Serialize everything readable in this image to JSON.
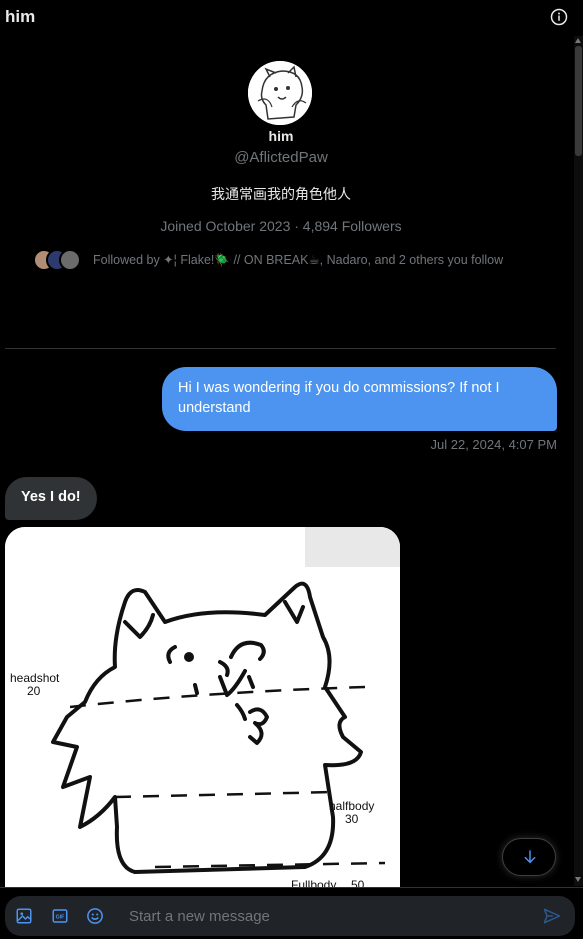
{
  "header": {
    "title": "him",
    "info_icon": "info-icon"
  },
  "profile": {
    "name": "him",
    "handle": "@AflictedPaw",
    "bio": "我通常画我的角色他人",
    "meta": "Joined October 2023 · 4,894 Followers",
    "followed_by": "Followed by ✦¦ Flake!🪲 // ON BREAK☕, Nadaro, and 2 others you follow"
  },
  "messages": {
    "sent_text": "Hi I was wondering if you do commissions? If not I understand",
    "sent_time": "Jul 22, 2024, 4:07 PM",
    "received_text": "Yes I do!",
    "image_labels": {
      "headshot": "headshot",
      "headshot_price": "20",
      "halfbody": "halfbody",
      "halfbody_price": "30",
      "fullbody": "Fullbody",
      "fullbody_price": "50"
    }
  },
  "composer": {
    "placeholder": "Start a new message",
    "icons": [
      "image-icon",
      "gif-icon",
      "emoji-icon",
      "send-icon"
    ]
  },
  "colors": {
    "accent": "#1d9bf0",
    "sent_bubble": "#4c94f0",
    "received_bubble": "#2f3336",
    "background": "#000000",
    "muted_text": "#71767b"
  }
}
